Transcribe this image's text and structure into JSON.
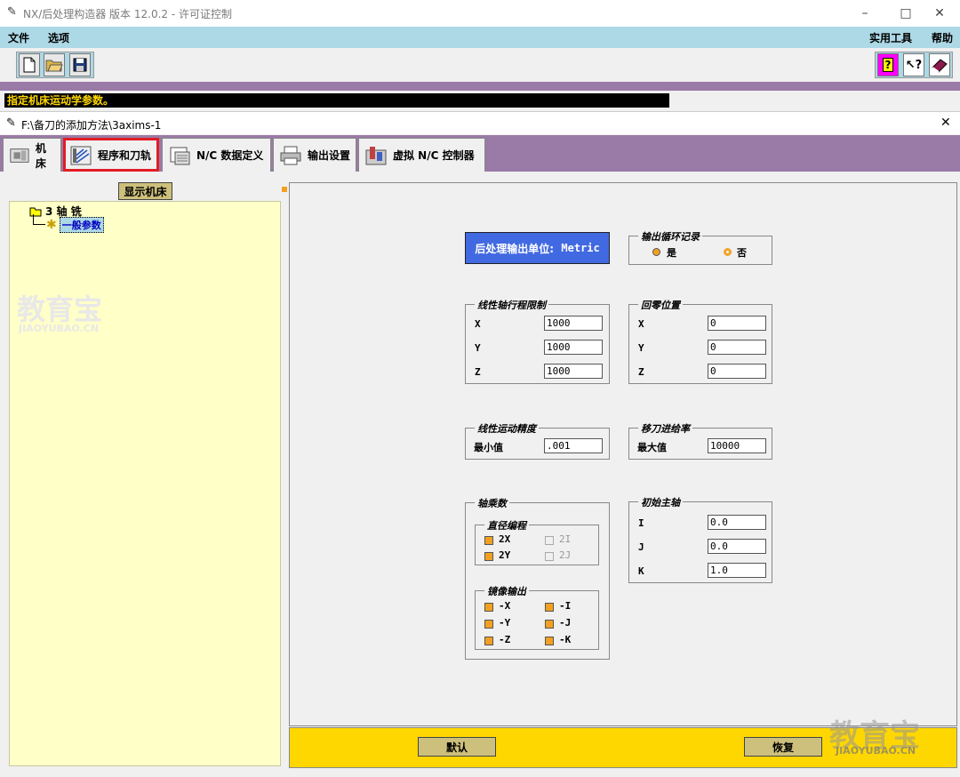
{
  "window": {
    "title": "NX/后处理构造器 版本 12.0.2 - 许可证控制"
  },
  "menu": {
    "file": "文件",
    "options": "选项",
    "utilities": "实用工具",
    "help": "帮助"
  },
  "status": "指定机床运动学参数。",
  "subwindow": {
    "title": "F:\\备刀的添加方法\\3axims-1"
  },
  "tabs": [
    "机床",
    "程序和刀轨",
    "N/C 数据定义",
    "输出设置",
    "虚拟 N/C 控制器"
  ],
  "tree": {
    "show_machine": "显示机床",
    "root": "3 轴 铣",
    "child": "一般参数"
  },
  "unit": {
    "label": "后处理输出单位:",
    "value": "Metric"
  },
  "circular": {
    "title": "输出循环记录",
    "yes": "是",
    "no": "否"
  },
  "travel_limit": {
    "title": "线性轴行程限制",
    "x_label": "X",
    "y_label": "Y",
    "z_label": "Z",
    "x": "1000",
    "y": "1000",
    "z": "1000"
  },
  "home": {
    "title": "回零位置",
    "x_label": "X",
    "y_label": "Y",
    "z_label": "Z",
    "x": "0",
    "y": "0",
    "z": "0"
  },
  "resolution": {
    "title": "线性运动精度",
    "label": "最小值",
    "value": ".001"
  },
  "traversal": {
    "title": "移刀进给率",
    "label": "最大值",
    "value": "10000"
  },
  "multiplier": {
    "title": "轴乘数",
    "diameter": {
      "title": "直径编程",
      "x2": "2X",
      "y2": "2Y",
      "i2": "2I",
      "j2": "2J"
    },
    "mirror": {
      "title": "镜像输出",
      "mx": "-X",
      "my": "-Y",
      "mz": "-Z",
      "mi": "-I",
      "mj": "-J",
      "mk": "-K"
    }
  },
  "spindle": {
    "title": "初始主轴",
    "i_label": "I",
    "j_label": "J",
    "k_label": "K",
    "i": "0.0",
    "j": "0.0",
    "k": "1.0"
  },
  "buttons": {
    "default": "默认",
    "restore": "恢复"
  },
  "watermark": {
    "text": "教育宝",
    "url": "JIAOYUBAO.CN"
  },
  "colors": {
    "menu_bg": "#add8e6",
    "tab_bar": "#9a7aa6",
    "tree_bg": "#ffffc8",
    "bottom_bar": "#ffd700",
    "unit_box": "#4169e1",
    "highlight": "#e31c25"
  }
}
